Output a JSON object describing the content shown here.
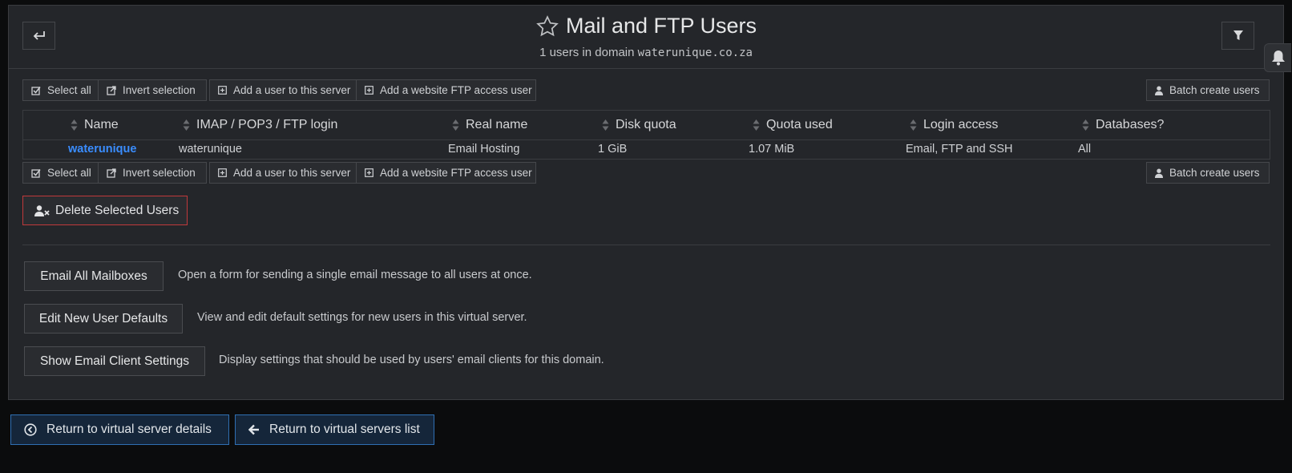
{
  "header": {
    "title": "Mail and FTP Users",
    "subtitle_prefix": "1 users in domain",
    "domain": "waterunique.co.za"
  },
  "toolbar": {
    "select_all": "Select all",
    "invert_selection": "Invert selection",
    "add_user": "Add a user to this server",
    "add_ftp_user": "Add a website FTP access user",
    "batch_create": "Batch create users"
  },
  "table": {
    "columns": [
      "Name",
      "IMAP / POP3 / FTP login",
      "Real name",
      "Disk quota",
      "Quota used",
      "Login access",
      "Databases?"
    ],
    "rows": [
      [
        "waterunique",
        "waterunique",
        "Email Hosting",
        "1 GiB",
        "1.07 MiB",
        "Email, FTP and SSH",
        "All"
      ]
    ]
  },
  "delete_button": "Delete Selected Users",
  "actions": [
    {
      "label": "Email All Mailboxes",
      "description": "Open a form for sending a single email message to all users at once."
    },
    {
      "label": "Edit New User Defaults",
      "description": "View and edit default settings for new users in this virtual server."
    },
    {
      "label": "Show Email Client Settings",
      "description": "Display settings that should be used by users' email clients for this domain."
    }
  ],
  "nav": {
    "return_details": "Return to virtual server details",
    "return_list": "Return to virtual servers list"
  },
  "colors": {
    "background": "#0b0c0d",
    "panel": "#24262a",
    "link": "#3a8dff",
    "danger_border": "#c0393b",
    "nav_border": "#2f6fb3"
  }
}
